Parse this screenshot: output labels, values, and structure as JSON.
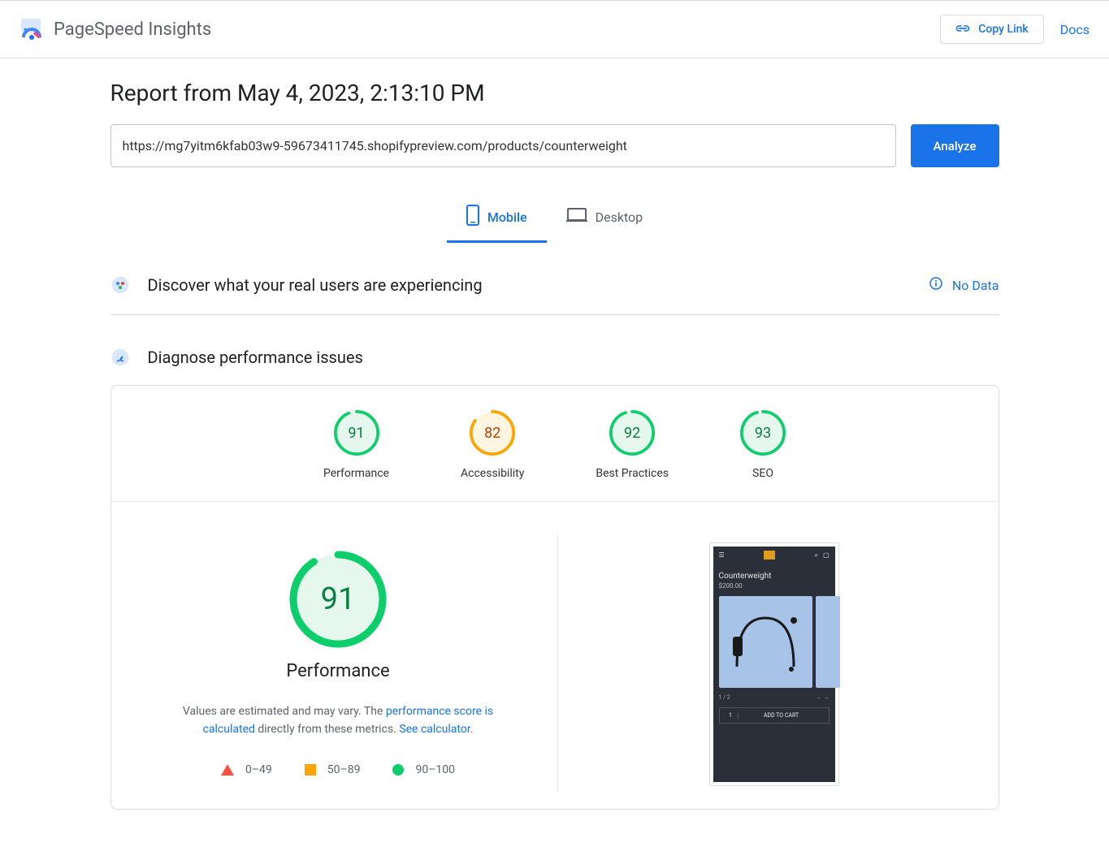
{
  "header": {
    "app_title": "PageSpeed Insights",
    "copy_link_label": "Copy Link",
    "docs_label": "Docs"
  },
  "report": {
    "title": "Report from May 4, 2023, 2:13:10 PM",
    "url_value": "https://mg7yitm6kfab03w9-59673411745.shopifypreview.com/products/counterweight",
    "analyze_label": "Analyze"
  },
  "tabs": {
    "mobile": "Mobile",
    "desktop": "Desktop"
  },
  "discover": {
    "title": "Discover what your real users are experiencing",
    "no_data": "No Data"
  },
  "diagnose": {
    "title": "Diagnose performance issues"
  },
  "gauges": [
    {
      "value": "91",
      "label": "Performance",
      "color": "green",
      "dash": "165 181"
    },
    {
      "value": "82",
      "label": "Accessibility",
      "color": "orange",
      "dash": "149 181"
    },
    {
      "value": "92",
      "label": "Best Practices",
      "color": "green",
      "dash": "167 181"
    },
    {
      "value": "93",
      "label": "SEO",
      "color": "green",
      "dash": "168 181"
    }
  ],
  "performance_big": {
    "value": "91",
    "label": "Performance",
    "dash": "314 346",
    "desc_pre": "Values are estimated and may vary. The ",
    "desc_link1": "performance score is calculated",
    "desc_mid": " directly from these metrics. ",
    "desc_link2": "See calculator",
    "desc_post": "."
  },
  "legend": {
    "poor": "0–49",
    "mid": "50–89",
    "good": "90–100"
  },
  "screenshot": {
    "product_title": "Counterweight",
    "price": "$200.00",
    "page": "1 / 2",
    "qty": "1",
    "add": "ADD TO CART"
  }
}
